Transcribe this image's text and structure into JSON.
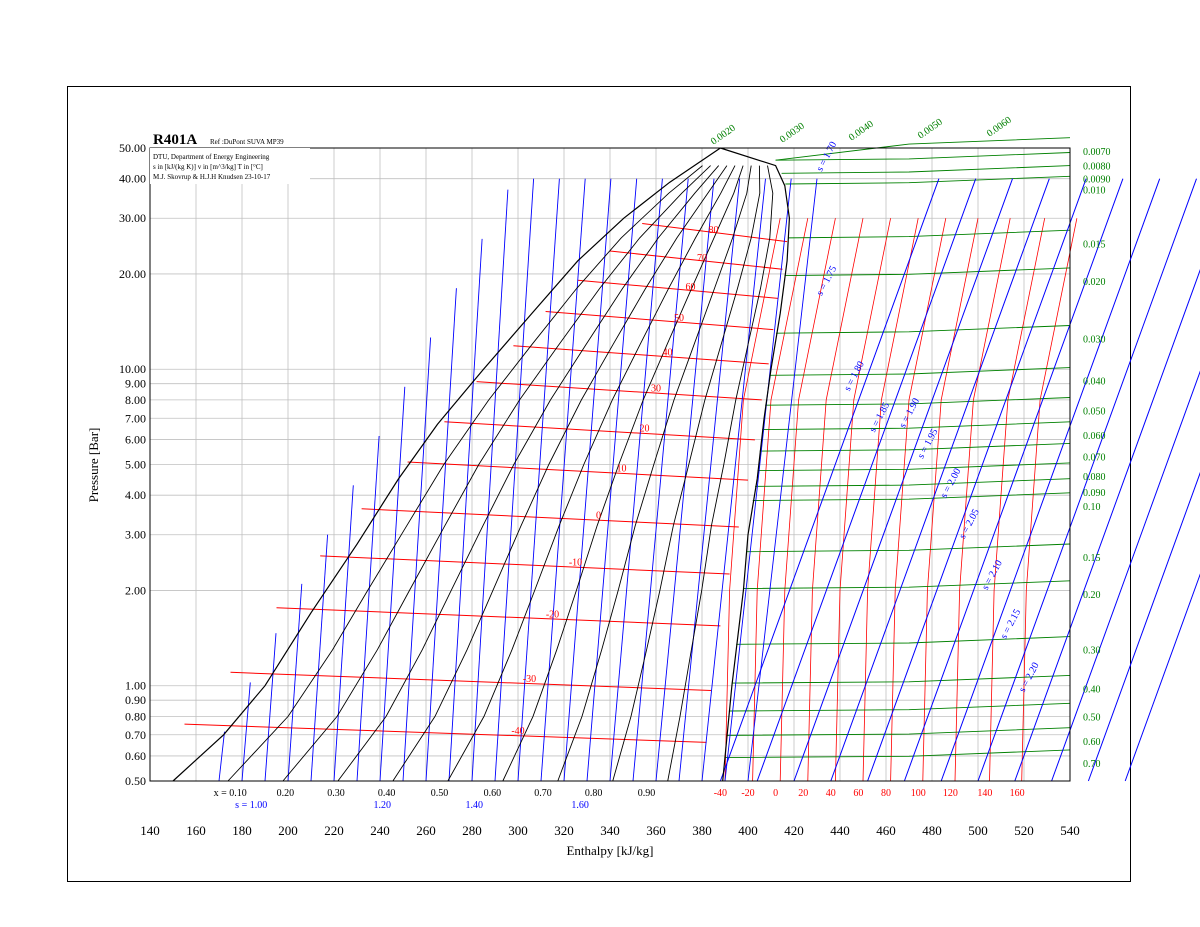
{
  "chart_data": {
    "type": "line",
    "title": "R401A",
    "reference": "Ref :DuPont SUVA MP39",
    "info_lines": [
      "DTU, Department of Energy Engineering",
      "s in [kJ/(kg K)] v in [m^3/kg] T in [°C]",
      "M.J. Skovrup & H.J.H Knudsen 23-10-17"
    ],
    "xlabel": "Enthalpy [kJ/kg]",
    "ylabel": "Pressure [Bar]",
    "xlim": [
      140,
      540
    ],
    "ylim": [
      0.5,
      50
    ],
    "y_scale": "log",
    "x_ticks": [
      140,
      160,
      180,
      200,
      220,
      240,
      260,
      280,
      300,
      320,
      340,
      360,
      380,
      400,
      420,
      440,
      460,
      480,
      500,
      520,
      540
    ],
    "y_ticks": [
      0.5,
      0.6,
      0.7,
      0.8,
      0.9,
      1.0,
      2.0,
      3.0,
      4.0,
      5.0,
      6.0,
      7.0,
      8.0,
      9.0,
      10.0,
      20.0,
      30.0,
      40.0,
      50.0
    ],
    "y_tick_labels": [
      "0.50",
      "0.60",
      "0.70",
      "0.80",
      "0.90",
      "1.00",
      "2.00",
      "3.00",
      "4.00",
      "5.00",
      "6.00",
      "7.00",
      "8.00",
      "9.00",
      "10.00",
      "20.00",
      "30.00",
      "40.00",
      "50.00"
    ],
    "colors": {
      "quality": "#000000",
      "entropy": "#0000ff",
      "temperature": "#ff0000",
      "volume": "#008000",
      "grid": "#c0c0c0"
    },
    "saturation": {
      "liquid": [
        [
          150,
          0.5
        ],
        [
          172,
          0.7
        ],
        [
          190,
          1.0
        ],
        [
          210,
          1.7
        ],
        [
          230,
          2.8
        ],
        [
          248,
          4.5
        ],
        [
          265,
          6.7
        ],
        [
          285,
          10
        ],
        [
          306,
          15
        ],
        [
          326,
          22
        ],
        [
          346,
          30
        ],
        [
          366,
          39
        ],
        [
          388,
          50
        ]
      ],
      "vapor": [
        [
          388,
          50
        ],
        [
          412,
          44
        ],
        [
          416,
          38
        ],
        [
          418,
          30
        ],
        [
          417,
          22
        ],
        [
          414,
          15
        ],
        [
          410,
          10
        ],
        [
          407,
          7
        ],
        [
          404,
          4.5
        ],
        [
          400,
          3
        ],
        [
          398,
          2
        ],
        [
          393,
          1
        ],
        [
          389,
          0.5
        ]
      ]
    },
    "quality_lines": {
      "labels": [
        "x = 0.10",
        "0.20",
        "0.30",
        "0.40",
        "0.50",
        "0.60",
        "0.70",
        "0.80",
        "0.90"
      ],
      "h_at_05": [
        174,
        198,
        220,
        242,
        265,
        288,
        310,
        332,
        355
      ]
    },
    "entropy_label_prefix": "s = ",
    "entropy_liquid_labels": [
      "s = 1.00",
      "1.20",
      "1.40",
      "1.60"
    ],
    "entropy_liquid_label_h": [
      184,
      241,
      281,
      327
    ],
    "entropy_vapor_labels": [
      {
        "s": "1.70",
        "h": 432,
        "p": 42
      },
      {
        "s": "1.75",
        "h": 432,
        "p": 17
      },
      {
        "s": "1.80",
        "h": 444,
        "p": 8.5
      },
      {
        "s": "1.85",
        "h": 455,
        "p": 6.3
      },
      {
        "s": "1.90",
        "h": 468,
        "p": 6.5
      },
      {
        "s": "1.95",
        "h": 476,
        "p": 5.2
      },
      {
        "s": "2.00",
        "h": 486,
        "p": 3.9
      },
      {
        "s": "2.05",
        "h": 494,
        "p": 2.9
      },
      {
        "s": "2.10",
        "h": 504,
        "p": 2.0
      },
      {
        "s": "2.15",
        "h": 512,
        "p": 1.4
      },
      {
        "s": "2.20",
        "h": 520,
        "p": 0.95
      }
    ],
    "isotherms": [
      {
        "T": "-40",
        "p": 0.72,
        "h_liq": 155,
        "h_vap": 382,
        "label_h": 300
      },
      {
        "T": "-30",
        "p": 1.05,
        "h_liq": 175,
        "h_vap": 384,
        "label_h": 305
      },
      {
        "T": "-20",
        "p": 1.68,
        "h_liq": 195,
        "h_vap": 388,
        "label_h": 315
      },
      {
        "T": "-10",
        "p": 2.45,
        "h_liq": 214,
        "h_vap": 392,
        "label_h": 325
      },
      {
        "T": "0",
        "p": 3.45,
        "h_liq": 232,
        "h_vap": 396,
        "label_h": 335
      },
      {
        "T": "10",
        "p": 4.85,
        "h_liq": 252,
        "h_vap": 400,
        "label_h": 345
      },
      {
        "T": "20",
        "p": 6.5,
        "h_liq": 268,
        "h_vap": 403,
        "label_h": 355
      },
      {
        "T": "30",
        "p": 8.7,
        "h_liq": 282,
        "h_vap": 406,
        "label_h": 360
      },
      {
        "T": "40",
        "p": 11.3,
        "h_liq": 298,
        "h_vap": 409,
        "label_h": 365
      },
      {
        "T": "50",
        "p": 14.5,
        "h_liq": 312,
        "h_vap": 411,
        "label_h": 370
      },
      {
        "T": "60",
        "p": 18.2,
        "h_liq": 326,
        "h_vap": 413,
        "label_h": 375
      },
      {
        "T": "70",
        "p": 22.5,
        "h_liq": 340,
        "h_vap": 415,
        "label_h": 380
      },
      {
        "T": "80",
        "p": 27.5,
        "h_liq": 354,
        "h_vap": 417,
        "label_h": 385
      }
    ],
    "vapor_temp_labels": [
      "-40",
      "-20",
      "0",
      "20",
      "40",
      "60",
      "80",
      "100",
      "120",
      "140",
      "160"
    ],
    "vapor_temp_h": [
      388,
      400,
      412,
      424,
      436,
      448,
      460,
      474,
      488,
      503,
      517
    ],
    "volume_labels": [
      {
        "v": "0.0020",
        "p": 52
      },
      {
        "v": "0.0030",
        "p": 52
      },
      {
        "v": "0.0040",
        "p": 52
      },
      {
        "v": "0.0050",
        "p": 52
      },
      {
        "v": "0.0060",
        "p": 52
      },
      {
        "v": "0.0070",
        "p": 49
      },
      {
        "v": "0.0080",
        "p": 44
      },
      {
        "v": "0.0090",
        "p": 40
      },
      {
        "v": "0.010",
        "p": 37
      },
      {
        "v": "0.015",
        "p": 25
      },
      {
        "v": "0.020",
        "p": 19
      },
      {
        "v": "0.030",
        "p": 12.5
      },
      {
        "v": "0.040",
        "p": 9.2
      },
      {
        "v": "0.050",
        "p": 7.4
      },
      {
        "v": "0.060",
        "p": 6.2
      },
      {
        "v": "0.070",
        "p": 5.3
      },
      {
        "v": "0.080",
        "p": 4.6
      },
      {
        "v": "0.090",
        "p": 4.1
      },
      {
        "v": "0.10",
        "p": 3.7
      },
      {
        "v": "0.15",
        "p": 2.55
      },
      {
        "v": "0.20",
        "p": 1.95
      },
      {
        "v": "0.30",
        "p": 1.3
      },
      {
        "v": "0.40",
        "p": 0.98
      },
      {
        "v": "0.50",
        "p": 0.8
      },
      {
        "v": "0.60",
        "p": 0.67
      },
      {
        "v": "0.70",
        "p": 0.57
      }
    ]
  }
}
